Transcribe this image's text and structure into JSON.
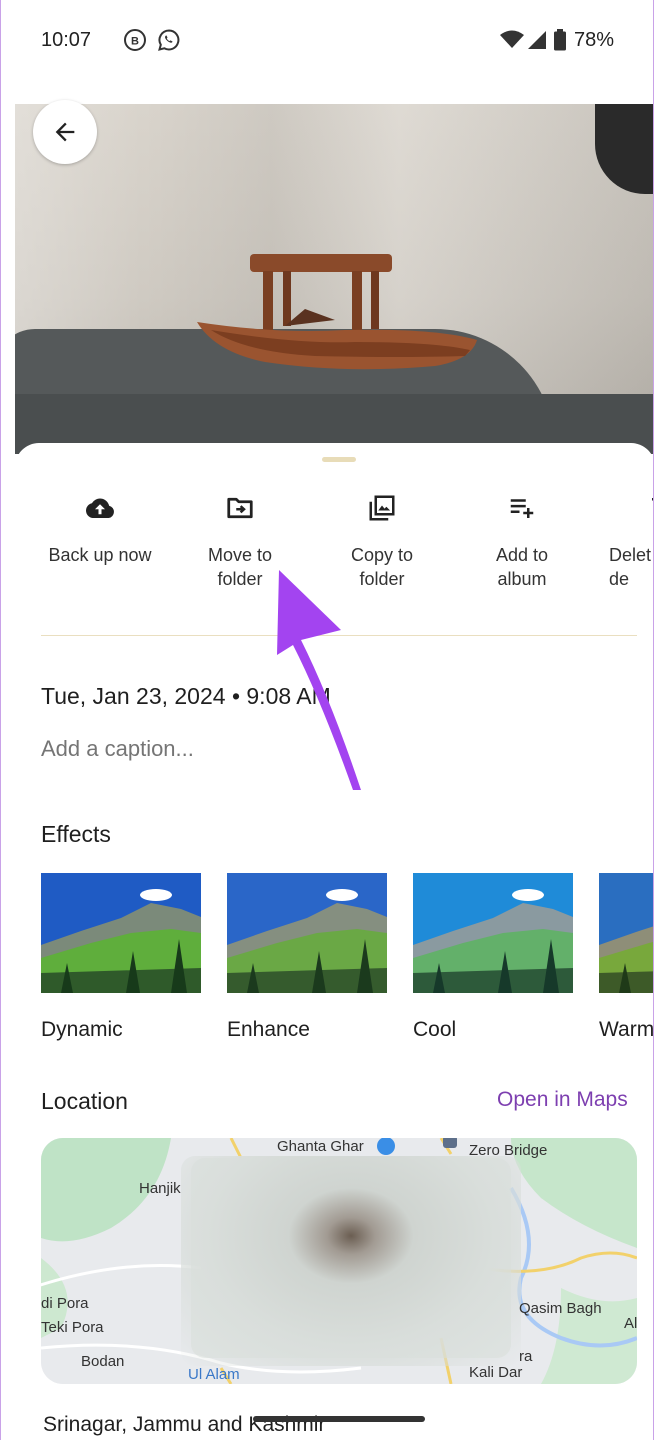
{
  "status_bar": {
    "time": "10:07",
    "notification_icons": [
      "b-icon",
      "whatsapp-icon"
    ],
    "battery": "78%"
  },
  "photo_viewer": {
    "back_icon": "arrow-left-icon"
  },
  "actions": [
    {
      "label": "Back up now",
      "icon": "cloud-upload-icon"
    },
    {
      "label": "Move to\nfolder",
      "icon": "folder-move-icon"
    },
    {
      "label": "Copy to\nfolder",
      "icon": "copy-to-folder-icon"
    },
    {
      "label": "Add to\nalbum",
      "icon": "add-to-album-icon"
    },
    {
      "label": "Delet\nde",
      "icon": "delete-icon"
    }
  ],
  "details": {
    "date": "Tue, Jan 23, 2024 • 9:08 AM",
    "caption_placeholder": "Add a caption..."
  },
  "effects": {
    "title": "Effects",
    "items": [
      {
        "label": "Dynamic"
      },
      {
        "label": "Enhance"
      },
      {
        "label": "Cool"
      },
      {
        "label": "Warm"
      }
    ]
  },
  "location": {
    "title": "Location",
    "open_maps": "Open in Maps",
    "map_labels": {
      "ghanta_ghar": "Ghanta Ghar",
      "zero_bridge": "Zero Bridge",
      "hanjik": "Hanjik",
      "di_pora": "di Pora",
      "teki_pora": "Teki Pora",
      "bodan": "Bodan",
      "ul_alam": "Ul Alam",
      "qasim_bagh": "Qasim Bagh",
      "al": "Al",
      "ra": "ra",
      "kali_dar": "Kali Dar"
    },
    "place": "Srinagar, Jammu and Kashmir"
  },
  "colors": {
    "accent": "#7d3fb0",
    "annotation_arrow": "#a344f0"
  }
}
